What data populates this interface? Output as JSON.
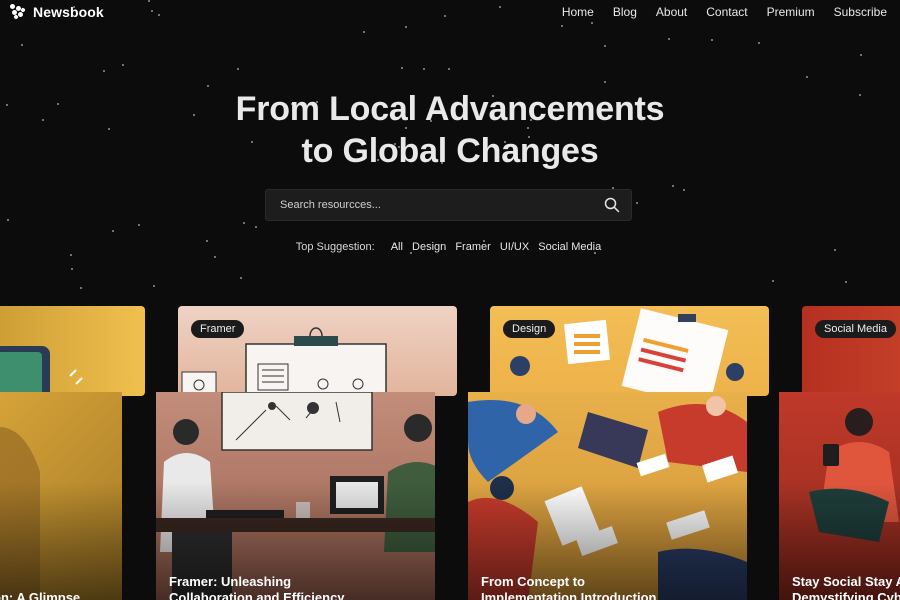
{
  "header": {
    "brand": "Newsbook",
    "nav": [
      "Home",
      "Blog",
      "About",
      "Contact",
      "Premium",
      "Subscribe"
    ]
  },
  "hero": {
    "title_line1": "From Local Advancements",
    "title_line2": "to Global Changes"
  },
  "search": {
    "placeholder": "Search resourcces..."
  },
  "suggestions": {
    "label": "Top Suggestion:",
    "tags": [
      "All",
      "Design",
      "Framer",
      "UI/UX",
      "Social Media"
    ]
  },
  "cards": [
    {
      "badge": "",
      "title_line1": "",
      "title_line2": "on: A Glimpse",
      "color": "#e7b84b"
    },
    {
      "badge": "Framer",
      "title_line1": "Framer: Unleashing",
      "title_line2": "Collaboration and Efficiency",
      "color": "#d8a98c"
    },
    {
      "badge": "Design",
      "title_line1": "From Concept to",
      "title_line2": "Implementation Introduction",
      "color": "#f0b94c"
    },
    {
      "badge": "Social Media",
      "title_line1": "Stay Social Stay A",
      "title_line2": "Demystifying Cyb",
      "color": "#c23a24"
    }
  ],
  "colors": {
    "background": "#0c0c0c",
    "search_bg": "#1d1d1d"
  }
}
